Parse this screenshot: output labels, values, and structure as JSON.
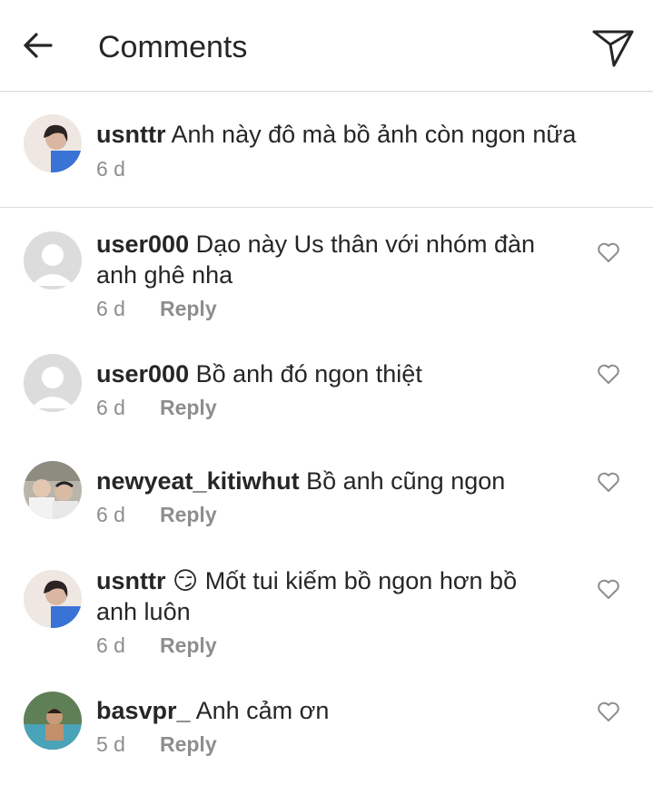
{
  "header": {
    "title": "Comments",
    "back_icon": "back-arrow-icon",
    "send_icon": "paper-plane-icon"
  },
  "caption": {
    "username": "usnttr",
    "text": "Anh này đô mà bồ ảnh còn ngon nữa",
    "age": "6 d"
  },
  "comments": [
    {
      "username": "user000",
      "text_line1": "Dạo này Us thân với nhóm đàn",
      "text_line2": "anh ghê nha",
      "age": "6 d",
      "reply": "Reply"
    },
    {
      "username": "user000",
      "text_line1": "Bồ anh đó ngon thiệt",
      "text_line2": "",
      "age": "6 d",
      "reply": "Reply"
    },
    {
      "username": "newyeat_kitiwhut",
      "text_line1": "Bồ anh cũng ngon",
      "text_line2": "",
      "age": "6 d",
      "reply": "Reply"
    },
    {
      "username": "usnttr",
      "emoji": "😏",
      "text_line1": "Mốt tui kiếm bồ ngon hơn bồ",
      "text_line2": "anh luôn",
      "age": "6 d",
      "reply": "Reply"
    },
    {
      "username": "basvpr_",
      "text_line1": "Anh cảm ơn",
      "text_line2": "",
      "age": "5 d",
      "reply": "Reply"
    }
  ],
  "colors": {
    "text": "#262626",
    "muted": "#8e8e8e",
    "divider": "#dbdbdb",
    "heart_outline": "#8e8e8e"
  }
}
